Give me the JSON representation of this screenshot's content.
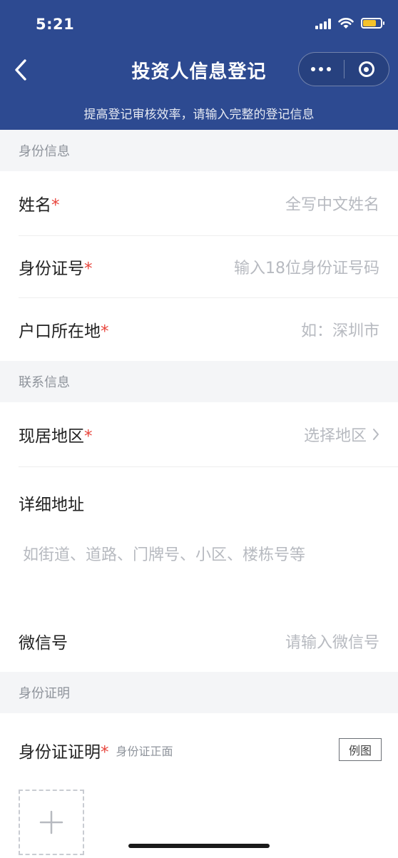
{
  "status_bar": {
    "time": "5:21"
  },
  "nav": {
    "title": "投资人信息登记",
    "subtitle": "提高登记审核效率，请输入完整的登记信息"
  },
  "sections": {
    "identity": "身份信息",
    "contact": "联系信息",
    "proof": "身份证明"
  },
  "fields": {
    "name": {
      "label": "姓名",
      "required_mark": "*",
      "placeholder": "全写中文姓名"
    },
    "id_number": {
      "label": "身份证号",
      "required_mark": "*",
      "placeholder": "输入18位身份证号码"
    },
    "hukou": {
      "label": "户口所在地",
      "required_mark": "*",
      "placeholder": "如：深圳市"
    },
    "region": {
      "label": "现居地区",
      "required_mark": "*",
      "placeholder": "选择地区"
    },
    "address": {
      "label": "详细地址",
      "placeholder": "如街道、道路、门牌号、小区、楼栋号等"
    },
    "wechat": {
      "label": "微信号",
      "placeholder": "请输入微信号"
    },
    "id_proof": {
      "label": "身份证证明",
      "required_mark": "*",
      "hint": "身份证正面",
      "example_button": "例图"
    }
  },
  "colors": {
    "header_bg": "#2d4a91",
    "required": "#e8453c",
    "battery": "#f4c22a"
  },
  "icons": {
    "back": "chevron-left-icon",
    "more": "more-dots-icon",
    "close": "record-circle-icon",
    "arrow": "chevron-right-icon",
    "upload": "plus-icon"
  }
}
